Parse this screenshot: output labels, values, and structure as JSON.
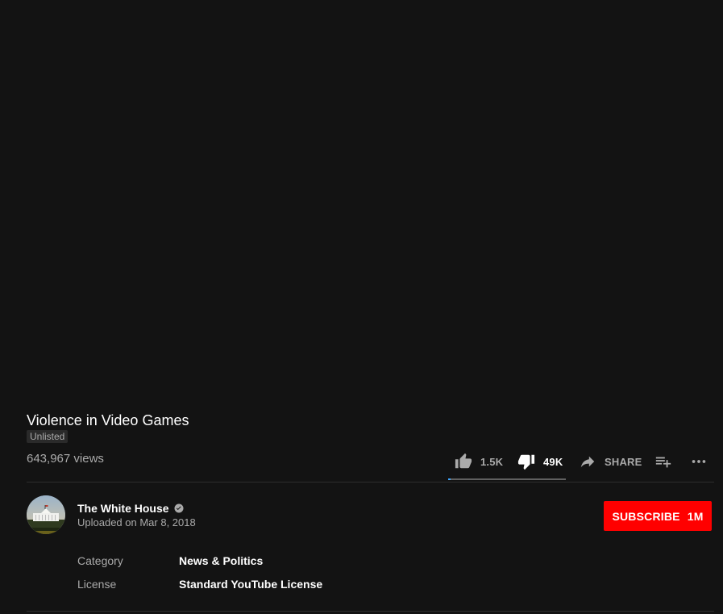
{
  "video": {
    "title": "Violence in Video Games",
    "badge": "Unlisted",
    "views": "643,967 views"
  },
  "actions": {
    "like_count": "1.5K",
    "dislike_count": "49K",
    "share_label": "SHARE",
    "like_ratio": 0.02,
    "accent_color": "#3ea6ff"
  },
  "channel": {
    "name": "The White House",
    "verified_icon": "verified-check-icon",
    "upload_date": "Uploaded on Mar 8, 2018"
  },
  "subscribe": {
    "label": "SUBSCRIBE",
    "count": "1M",
    "color": "#ff0000"
  },
  "metadata": [
    {
      "label": "Category",
      "value": "News & Politics"
    },
    {
      "label": "License",
      "value": "Standard YouTube License"
    }
  ],
  "icons": {
    "like": "thumbs-up-icon",
    "dislike": "thumbs-down-icon",
    "share": "share-arrow-icon",
    "save": "add-to-playlist-icon",
    "more": "more-horizontal-icon"
  }
}
